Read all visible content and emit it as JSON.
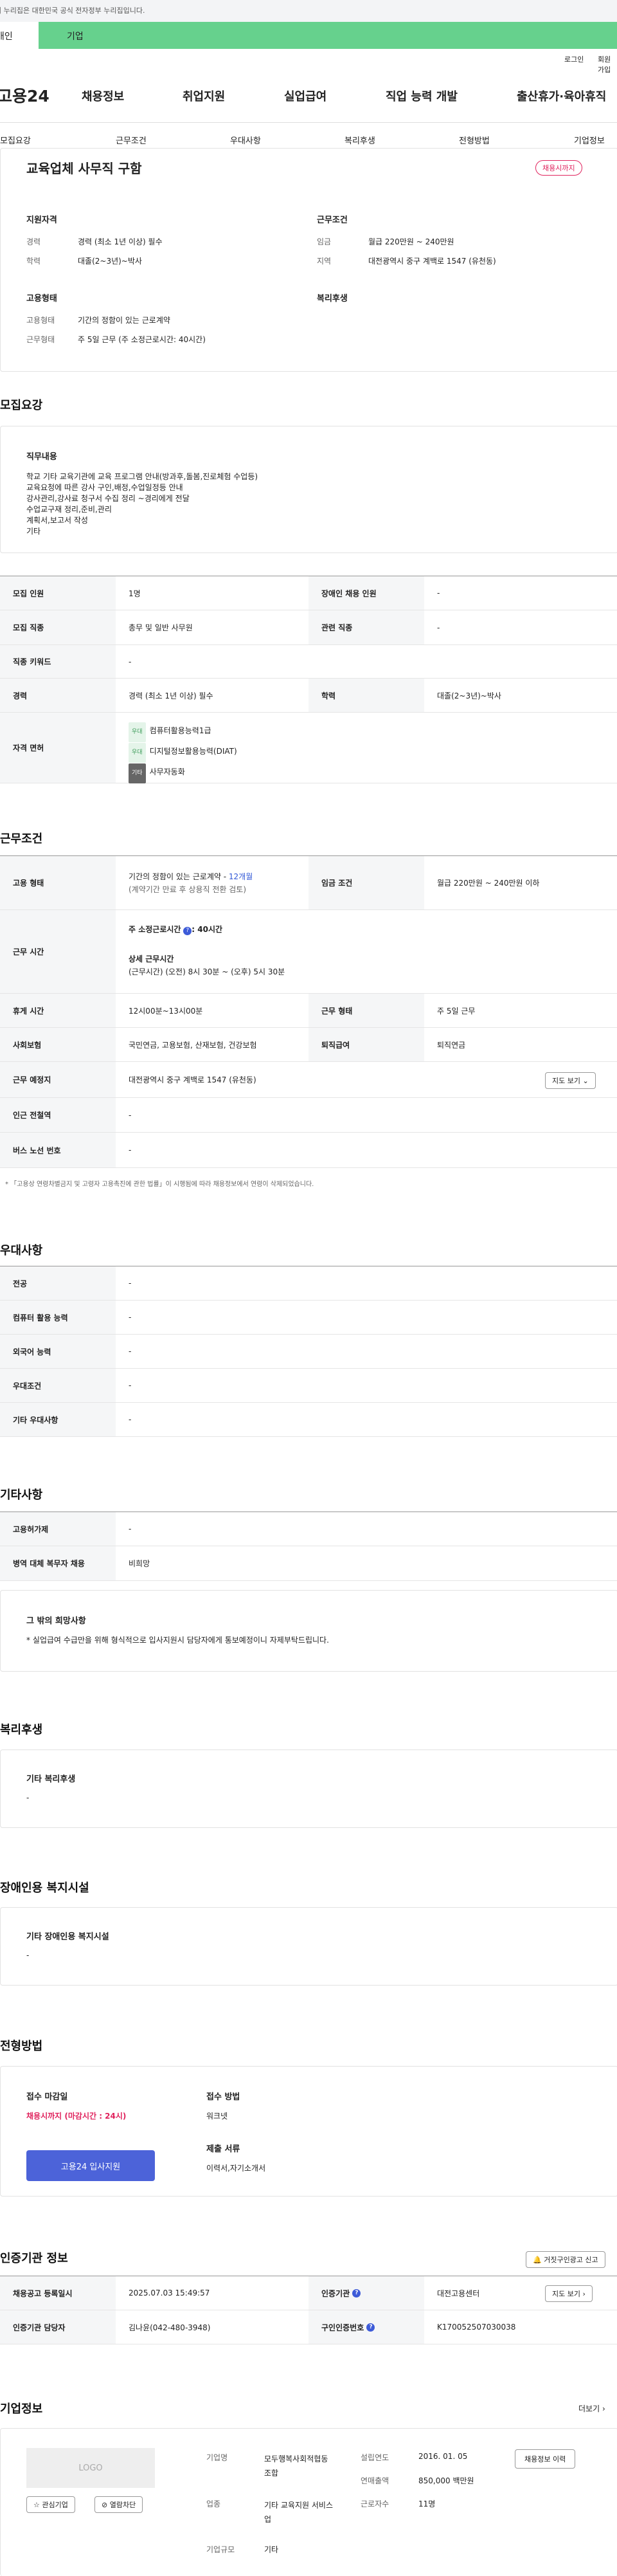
{
  "gov_banner": "이 누리집은 대한민국 공식 전자정부 누리집입니다.",
  "tabs": {
    "personal": "개인",
    "corp": "기업"
  },
  "util": {
    "login": "로그인",
    "join": "회원가입"
  },
  "logo": "고용24",
  "gnb": [
    "채용정보",
    "취업지원",
    "실업급여",
    "직업 능력 개발",
    "출산휴가·육아휴직"
  ],
  "subnav": [
    "모집요강",
    "근무조건",
    "우대사항",
    "복리후생",
    "전형방법",
    "기업정보"
  ],
  "summary": {
    "title": "교육업체 사무직 구함",
    "status_badge": "채용시까지",
    "qual_head": "지원자격",
    "career_label": "경력",
    "career_value": "경력 (최소 1년 이상) 필수",
    "edu_label": "학력",
    "edu_value": "대졸(2~3년)~박사",
    "cond_head": "근무조건",
    "wage_label": "임금",
    "wage_value": "월급 220만원 ~ 240만원",
    "region_label": "지역",
    "region_value": "대전광역시 중구 계백로 1547 (유천동)",
    "emp_head": "고용형태",
    "emp_label": "고용형태",
    "emp_value": "기간의 정함이 있는 근로계약",
    "work_label": "근무형태",
    "work_value": "주 5일 근무 (주 소정근로시간: 40시간)",
    "welfare_head": "복리후생"
  },
  "recruit": {
    "heading": "모집요강",
    "duty_head": "직무내용",
    "duty_lines": [
      "학교 기타 교육기관에 교육 프로그램 안내(방과후,돌봄,진로체험 수업등)",
      "교육요청에 따른 강사 구인,배정,수업일정등 안내",
      "강사관리,강사료 청구서 수집 정리 ~경리에게 전달",
      "수업교구재 정리,준비,관리",
      "계획서,보고서 작성",
      "기타"
    ],
    "count_label": "모집 인원",
    "count_value": "1명",
    "disabled_label": "장애인 채용 인원",
    "disabled_value": "-",
    "job_label": "모집 직종",
    "job_value": "총무 및 일반 사무원",
    "related_label": "관련 직종",
    "related_value": "-",
    "keyword_label": "직종 키워드",
    "keyword_value": "-",
    "career_label": "경력",
    "career_value": "경력 (최소 1년 이상) 필수",
    "edu_label": "학력",
    "edu_value": "대졸(2~3년)~박사",
    "license_label": "자격 면허",
    "licenses": [
      {
        "badge": "우대",
        "name": "컴퓨터활용능력1급"
      },
      {
        "badge": "우대",
        "name": "디지털정보활용능력(DIAT)"
      },
      {
        "badge": "기타",
        "name": "사무자동화"
      }
    ]
  },
  "work": {
    "heading": "근무조건",
    "emp_label": "고용 형태",
    "emp_value": "기간의 정함이 있는 근로계약 - ",
    "emp_months": "12개월",
    "emp_note": "(계약기간 만료 후 상용직 전환 검토)",
    "wage_label": "임금 조건",
    "wage_value": "월급 220만원 ~ 240만원 이하",
    "hours_label": "근무 시간",
    "hours_week_label": "주 소정근로시간",
    "hours_week_value": ": 40시간",
    "hours_detail_label": "상세 근무시간",
    "hours_detail_value": "(근무시간) (오전) 8시 30분 ~ (오후) 5시 30분",
    "rest_label": "휴게 시간",
    "rest_value": "12시00분~13시00분",
    "form_label": "근무 형태",
    "form_value": "주 5일 근무",
    "ins_label": "사회보험",
    "ins_value": "국민연금, 고용보험, 산재보험, 건강보험",
    "retire_label": "퇴직급여",
    "retire_value": "퇴직연금",
    "place_label": "근무 예정지",
    "place_value": "대전광역시 중구 계백로 1547 (유천동)",
    "map_btn": "지도 보기",
    "station_label": "인근 전철역",
    "station_value": "-",
    "bus_label": "버스 노선 번호",
    "bus_value": "-",
    "notice": "* 「고용상 연령차별금지 및 고령자 고용촉진에 관한 법률」이 시행됨에 따라 채용정보에서 연령이 삭제되었습니다."
  },
  "pref": {
    "heading": "우대사항",
    "rows": [
      {
        "label": "전공",
        "value": "-"
      },
      {
        "label": "컴퓨터 활용 능력",
        "value": "-"
      },
      {
        "label": "외국어 능력",
        "value": "-"
      },
      {
        "label": "우대조건",
        "value": "-"
      },
      {
        "label": "기타 우대사항",
        "value": "-"
      }
    ]
  },
  "etc": {
    "heading": "기타사항",
    "rows": [
      {
        "label": "고용허가제",
        "value": "-"
      },
      {
        "label": "병역 대체 복무자 채용",
        "value": "비희망"
      }
    ],
    "other_head": "그 밖의 희망사항",
    "other_text": "* 실업급여 수급만을 위해 형식적으로 입사지원시 담당자에게 통보예정이니 자제부탁드립니다."
  },
  "welfare": {
    "heading": "복리후생",
    "head": "기타 복리후생",
    "value": "-"
  },
  "disabled_fac": {
    "heading": "장애인용 복지시설",
    "head": "기타 장애인용 복지시설",
    "value": "-"
  },
  "process": {
    "heading": "전형방법",
    "deadline_label": "접수 마감일",
    "deadline_value": "채용시까지 (마감시간 : 24시)",
    "apply_btn": "고용24 입사지원",
    "method_label": "접수 방법",
    "method_value": "워크넷",
    "doc_label": "제출 서류",
    "doc_value": "이력서,자기소개서"
  },
  "cert": {
    "heading": "인증기관 정보",
    "report_btn": "거짓구인광고 신고",
    "reg_label": "채용공고 등록일시",
    "reg_value": "2025.07.03 15:49:57",
    "org_label": "인증기관",
    "org_value": "대전고용센터",
    "map_btn": "지도 보기",
    "mgr_label": "인증기관 담당자",
    "mgr_value": "김나윤(042-480-3948)",
    "num_label": "구인인증번호",
    "num_value": "K170052507030038"
  },
  "company": {
    "heading": "기업정보",
    "more": "더보기",
    "logo": "LOGO",
    "fav_btn": "관심기업",
    "block_btn": "열람차단",
    "name_label": "기업명",
    "name_value": "모두행복사회적협동조합",
    "biz_label": "업종",
    "biz_value": "기타 교육지원 서비스업",
    "size_label": "기업규모",
    "size_value": "기타",
    "found_label": "설립연도",
    "found_value": "2016. 01. 05",
    "sales_label": "연매출액",
    "sales_value": "850,000 백만원",
    "staff_label": "근로자수",
    "staff_value": "11명",
    "jobs_btn": "채용정보 이력"
  },
  "colors": {
    "accent": "#e0245e",
    "primary_btn": "#4c63d9",
    "corp_tab": "#66d18d"
  }
}
